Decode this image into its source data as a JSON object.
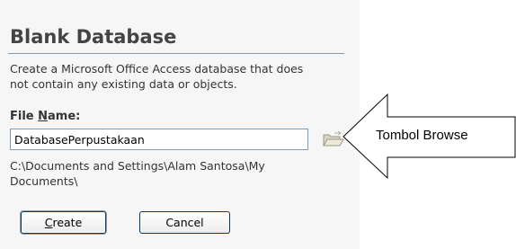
{
  "dialog": {
    "title": "Blank Database",
    "description_lines": [
      "Create a Microsoft Office Access database that does",
      "not contain any existing data or objects."
    ],
    "file_name_label_accel": "N",
    "file_name_label_pre": "File ",
    "file_name_label_post": "ame:",
    "file_name_value": "DatabasePerpustakaan",
    "path_lines": [
      "C:\\Documents and Settings\\Alam Santosa\\My",
      "Documents\\"
    ],
    "create_accel": "C",
    "create_rest": "reate",
    "cancel_label": "Cancel",
    "browse_icon": "folder-open-icon"
  },
  "annotation": {
    "label": "Tombol Browse"
  },
  "colors": {
    "panel_bg": "#f6f6f6",
    "title": "#444444",
    "input_border": "#7f9db9",
    "button_border": "#003c74"
  }
}
